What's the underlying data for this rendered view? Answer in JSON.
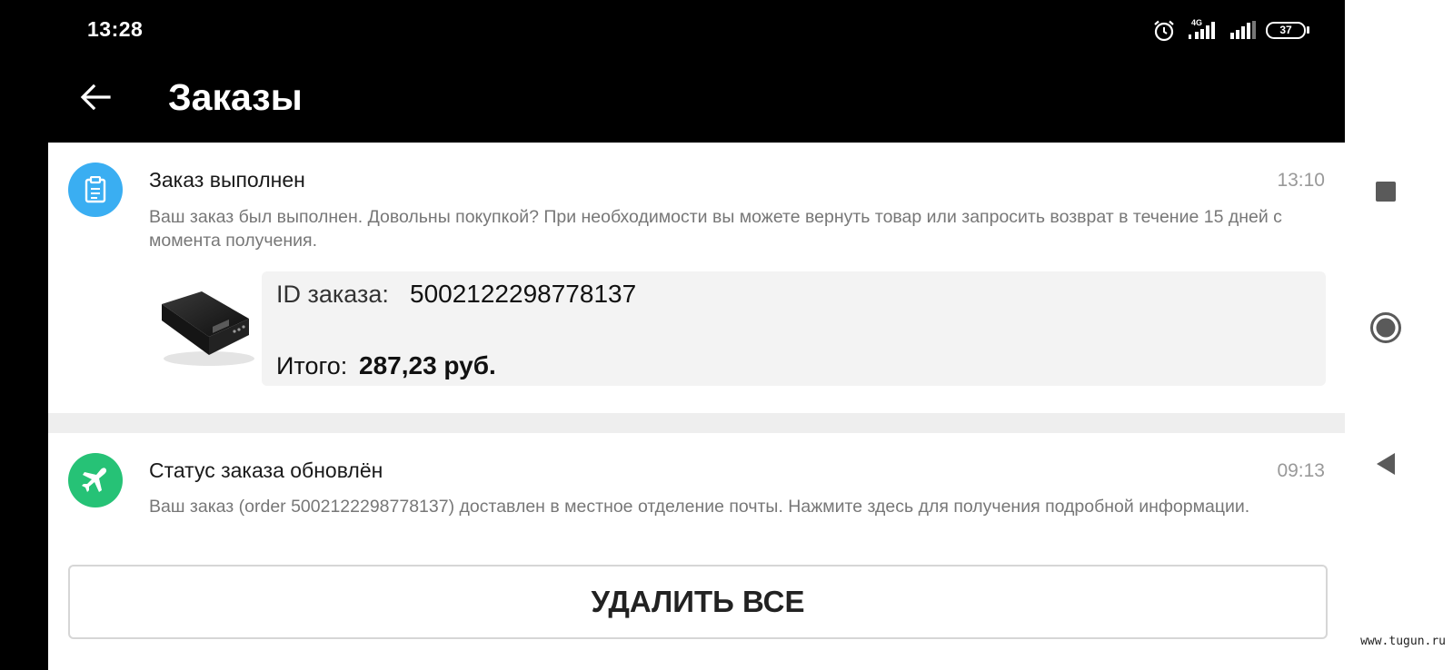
{
  "status_bar": {
    "time": "13:28",
    "network": "4G",
    "battery": "37"
  },
  "header": {
    "title": "Заказы"
  },
  "notifications": [
    {
      "title": "Заказ выполнен",
      "time": "13:10",
      "body": "Ваш заказ был выполнен. Довольны покупкой? При необходимости вы можете вернуть товар или запросить возврат в течение 15 дней с момента получения.",
      "icon": "clipboard-icon",
      "icon_color": "#3aaef2",
      "order": {
        "id_label": "ID заказа:",
        "id_value": "5002122298778137",
        "total_label": "Итого:",
        "total_value": "287,23 руб."
      }
    },
    {
      "title": "Статус заказа обновлён",
      "time": "09:13",
      "body": "Ваш заказ (order 5002122298778137) доставлен в местное отделение почты. Нажмите здесь для получения подробной информации.",
      "icon": "airplane-icon",
      "icon_color": "#26c276"
    }
  ],
  "actions": {
    "delete_all": "УДАЛИТЬ ВСЕ"
  },
  "watermark": "www.tugun.ru"
}
